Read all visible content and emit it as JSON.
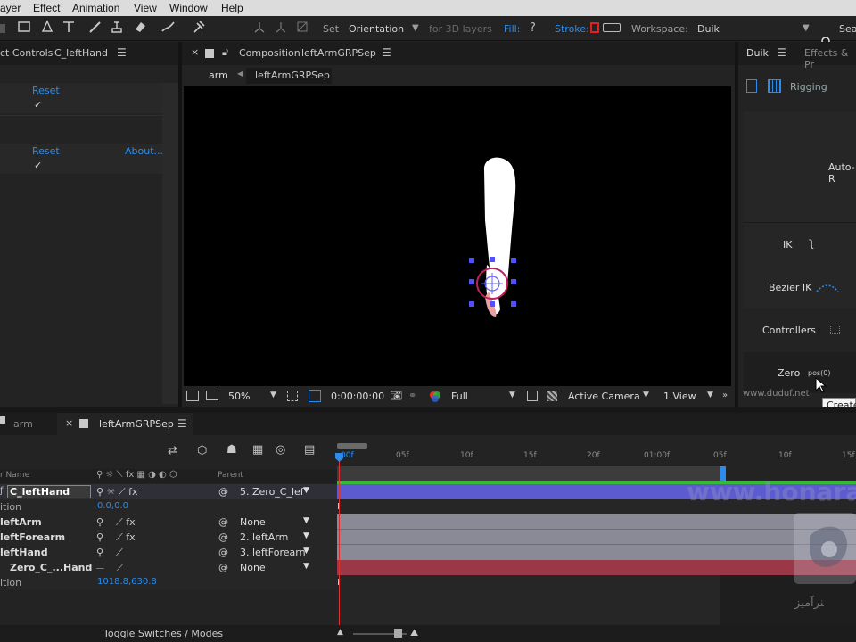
{
  "menubar": {
    "items": [
      "ayer",
      "Effect",
      "Animation",
      "View",
      "Window",
      "Help"
    ]
  },
  "toolbar": {
    "set_label": "Set",
    "orientation_value": "Orientation",
    "for3d_label": "for 3D layers",
    "fill_label": "Fill:",
    "stroke_label": "Stroke:",
    "workspace_label": "Workspace:",
    "workspace_value": "Duik",
    "search_label": "Sea"
  },
  "effect_controls": {
    "tab_prefix": "ct Controls",
    "tab_layer": "C_leftHand",
    "rows": [
      {
        "link": "Reset",
        "about": ""
      },
      {
        "check": "✓"
      },
      {
        "link": "Reset",
        "about": "About..."
      },
      {
        "check": "✓"
      }
    ]
  },
  "composition": {
    "tab_label": "Composition",
    "tab_name": "leftArmGRPSep",
    "breadcrumb_1": "arm",
    "breadcrumb_2": "leftArmGRPSep",
    "zoom": "50%",
    "timecode": "0:00:00:00",
    "resolution": "Full",
    "camera": "Active Camera",
    "views": "1 View"
  },
  "duik": {
    "tab_label": "Duik",
    "tab2_label": "Effects & Pr",
    "rigging_label": "Rigging",
    "auto_label": "Auto-R",
    "ik_label": "IK",
    "bezier_label": "Bezier IK",
    "controllers_label": "Controllers",
    "zero_label": "Zero",
    "pos_label": "pos(0)",
    "url": "www.duduf.net",
    "tooltip": "Create"
  },
  "timeline": {
    "tab1": "arm",
    "tab2": "leftArmGRPSep",
    "col_name": "r Name",
    "col_parent": "Parent",
    "ruler": [
      "00f",
      "05f",
      "10f",
      "15f",
      "20f",
      "01:00f",
      "05f",
      "10f",
      "15f"
    ],
    "toggle_label": "Toggle Switches / Modes",
    "layers": [
      {
        "name": "C_leftHand",
        "parent": "5. Zero_C_lef",
        "sub": false,
        "fx": true
      },
      {
        "name": "ition",
        "value": "0.0,0.0",
        "sub": true
      },
      {
        "name": "leftArm",
        "parent": "None",
        "sub": false,
        "fx": true
      },
      {
        "name": "leftForearm",
        "parent": "2. leftArm",
        "sub": false,
        "fx": true
      },
      {
        "name": "leftHand",
        "parent": "3. leftForearn",
        "sub": false,
        "fx": false
      },
      {
        "name": "Zero_C_...Hand",
        "parent": "None",
        "sub": false,
        "fx": false
      },
      {
        "name": "ition",
        "value": "1018.8,630.8",
        "sub": true
      }
    ]
  },
  "watermark": {
    "text": "www.honara",
    "logo_text": "ﻨﺮآﻣﻴﺰ"
  },
  "colors": {
    "accent": "#2d8ceb",
    "selected_bar": "#5c5cd0",
    "red_bar": "#9a3848",
    "layer_bar": "#8a8a96",
    "green": "#38b838"
  }
}
